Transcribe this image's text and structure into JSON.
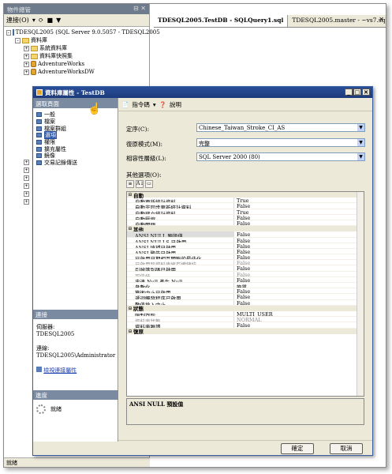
{
  "object_explorer": {
    "title": "物件總管",
    "connect_label": "連接(O)",
    "tree": [
      {
        "indent": 0,
        "pm": "-",
        "icon": "server",
        "text": "TDESQL2005 (SQL Server 9.0.5057 - TDESQL2005"
      },
      {
        "indent": 1,
        "pm": "-",
        "icon": "folder",
        "text": "資料庫"
      },
      {
        "indent": 2,
        "pm": "+",
        "icon": "folder",
        "text": "系統資料庫"
      },
      {
        "indent": 2,
        "pm": "+",
        "icon": "folder",
        "text": "資料庫快照集"
      },
      {
        "indent": 2,
        "pm": "+",
        "icon": "db",
        "text": "AdventureWorks"
      },
      {
        "indent": 2,
        "pm": "+",
        "icon": "db",
        "text": "AdventureWorksDW"
      }
    ],
    "status": "就緒"
  },
  "tabs": [
    "TDESQL2005.TestDB - SQLQuery1.sql",
    "TDESQL2005.master - ~vs7.sql"
  ],
  "dialog": {
    "title": "資料庫屬性 - TestDB",
    "select_page_header": "選取頁面",
    "pages": [
      "一般",
      "檔案",
      "檔案群組",
      "選項",
      "權限",
      "擴充屬性",
      "鏡像",
      "交易記錄傳送"
    ],
    "selected_page": 3,
    "connection_header": "連接",
    "server_label": "伺服器:",
    "server_value": "TDESQL2005",
    "conn_label": "連線:",
    "conn_value": "TDESQL2005\\Administrator",
    "view_conn_props": "檢視連接屬性",
    "progress_header": "進度",
    "progress_status": "就緒",
    "script_label": "指令碼",
    "help_label": "說明",
    "collation_label": "定序(C):",
    "collation_value": "Chinese_Taiwan_Stroke_CI_AS",
    "recovery_label": "復原模式(M):",
    "recovery_value": "完整",
    "compat_label": "相容性層級(L):",
    "compat_value": "SQL Server 2000 (80)",
    "other_options_label": "其他選項(O):",
    "ok_label": "確定",
    "cancel_label": "取消",
    "description": "ANSI NULL 預設值",
    "grid": [
      {
        "cat": "自動"
      },
      {
        "name": "自動更新統計資料",
        "value": "True"
      },
      {
        "name": "自動非同步更新統計資料",
        "value": "False"
      },
      {
        "name": "自動建立統計資料",
        "value": "True"
      },
      {
        "name": "自動壓縮",
        "value": "False"
      },
      {
        "name": "自動關閉",
        "value": "False"
      },
      {
        "cat": "其他"
      },
      {
        "name": "ANSI NULL 預設值",
        "value": "False",
        "sel": true
      },
      {
        "name": "ANSI NULLS 已啟用",
        "value": "False"
      },
      {
        "name": "ANSI 填補已啟用",
        "value": "False"
      },
      {
        "name": "ANSI 警告已啟用",
        "value": "False"
      },
      {
        "name": "已啟用日期相互關聯的最佳化",
        "value": "False"
      },
      {
        "name": "已啟用跨資料庫擁有權鏈結",
        "value": "False",
        "dim": true
      },
      {
        "name": "引號識別碼已啟用",
        "value": "False"
      },
      {
        "name": "可信任",
        "value": "False",
        "dim": true
      },
      {
        "name": "串連 Null 產生 Null",
        "value": "False"
      },
      {
        "name": "參數化",
        "value": "簡單"
      },
      {
        "name": "算術中止已啟用",
        "value": "False"
      },
      {
        "name": "遞迴觸發程序已啟用",
        "value": "False"
      },
      {
        "name": "數值捨入中止",
        "value": "False"
      },
      {
        "cat": "狀態"
      },
      {
        "name": "限制存取",
        "value": "MULTI_USER"
      },
      {
        "name": "資料庫狀態",
        "value": "NORMAL",
        "dim": true
      },
      {
        "name": "資料庫唯讀",
        "value": "False"
      },
      {
        "cat": "復原"
      }
    ]
  }
}
